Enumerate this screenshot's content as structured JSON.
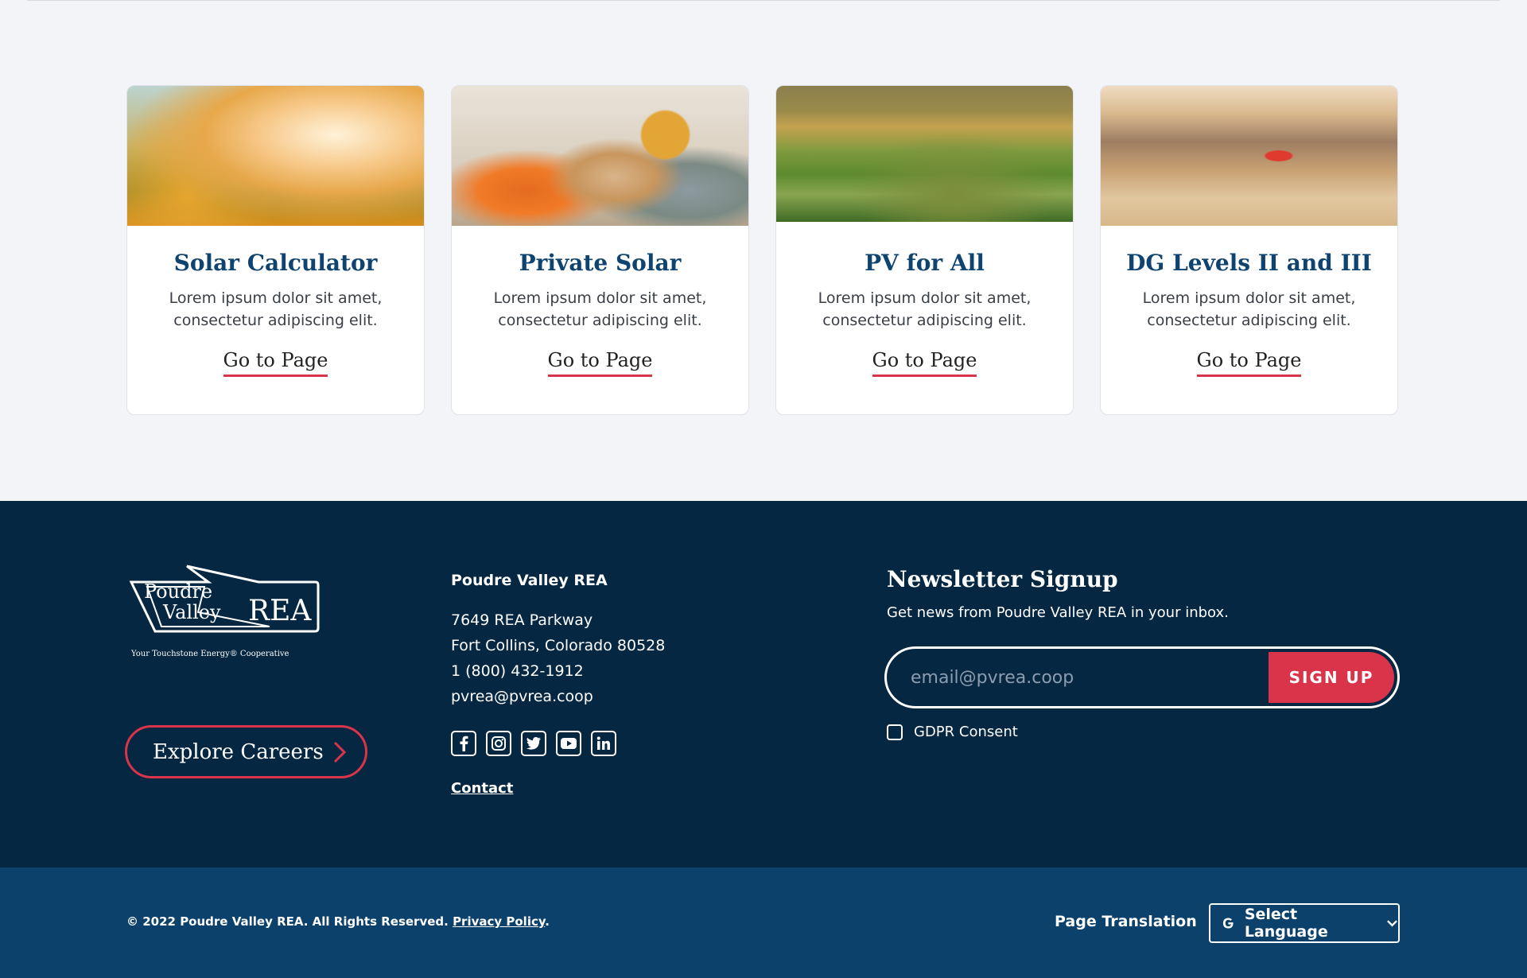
{
  "cards": [
    {
      "title": "Solar Calculator",
      "text": "Lorem ipsum dolor sit amet, consectetur adipiscing elit.",
      "link": "Go to Page"
    },
    {
      "title": "Private Solar",
      "text": "Lorem ipsum dolor sit amet, consectetur adipiscing elit.",
      "link": "Go to Page"
    },
    {
      "title": "PV for All",
      "text": "Lorem ipsum dolor sit amet, consectetur adipiscing elit.",
      "link": "Go to Page"
    },
    {
      "title": "DG Levels II and III",
      "text": "Lorem ipsum dolor sit amet, consectetur adipiscing elit.",
      "link": "Go to Page"
    }
  ],
  "footer": {
    "logo": {
      "line1": "Poudre",
      "line2": "Valley",
      "mark": "REA",
      "tagline": "Your Touchstone Energy® Cooperative"
    },
    "careers_label": "Explore Careers",
    "org_name": "Poudre Valley REA",
    "address": [
      "7649 REA Parkway",
      "Fort Collins, Colorado 80528",
      "1 (800) 432-1912",
      "pvrea@pvrea.coop"
    ],
    "socials": [
      "facebook-icon",
      "instagram-icon",
      "twitter-icon",
      "youtube-icon",
      "linkedin-icon"
    ],
    "contact_label": "Contact",
    "newsletter": {
      "title": "Newsletter Signup",
      "subtitle": "Get news from Poudre Valley REA in your inbox.",
      "placeholder": "email@pvrea.coop",
      "button": "SIGN UP",
      "gdpr_label": "GDPR Consent"
    }
  },
  "bottom": {
    "copyright": "© 2022 Poudre Valley REA. All Rights Reserved.",
    "privacy": "Privacy Policy",
    "period": ".",
    "translation_label": "Page Translation",
    "language": "Select Language"
  },
  "colors": {
    "navy": "#062742",
    "blue": "#0b416a",
    "accent": "#d9344a",
    "title": "#0f4470",
    "bg": "#f3f4f8"
  }
}
